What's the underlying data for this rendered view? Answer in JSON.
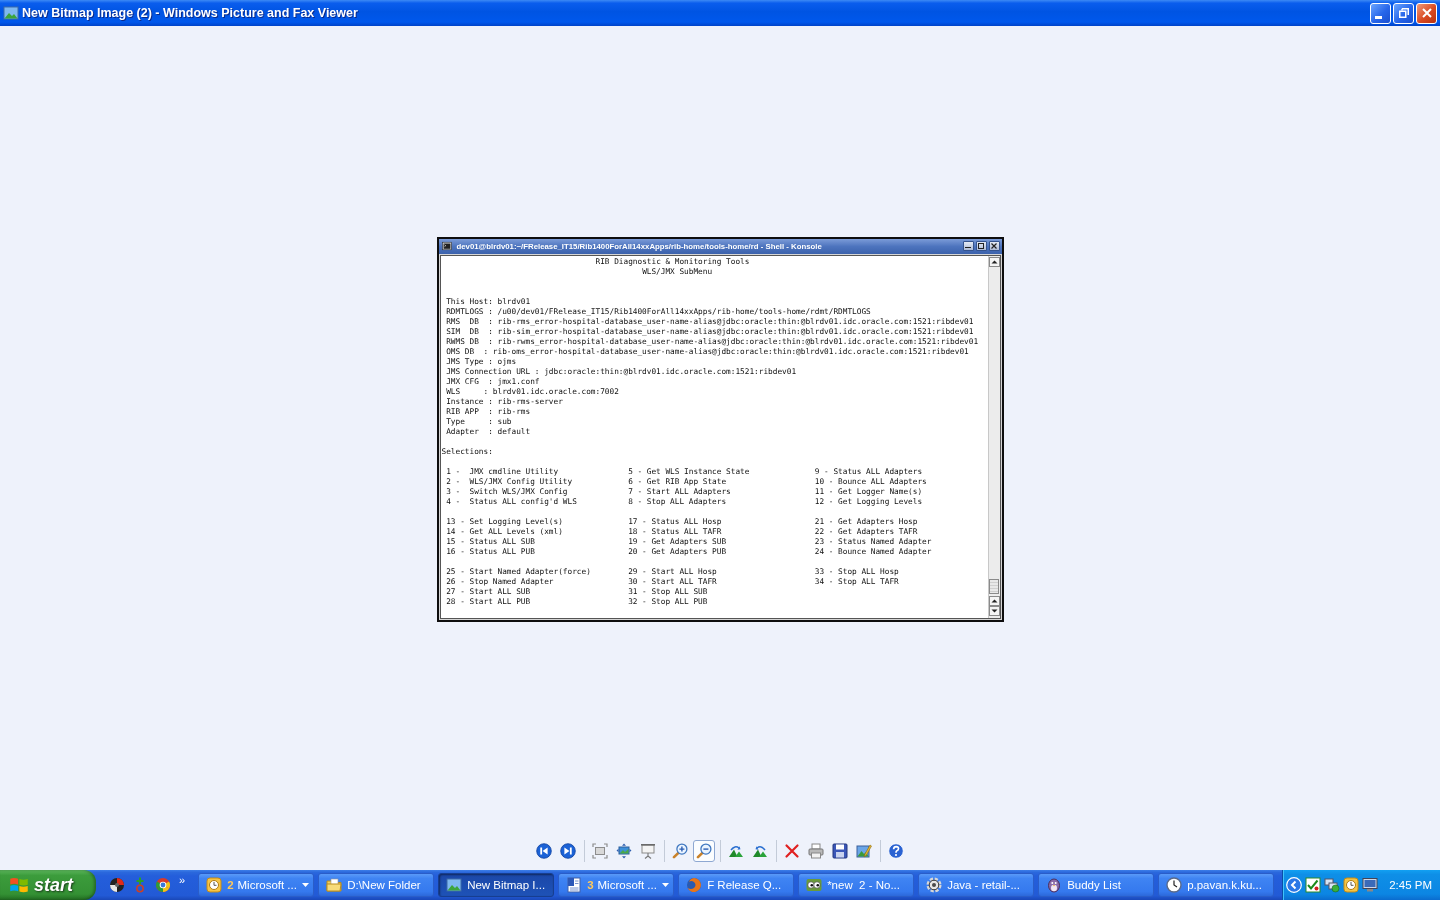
{
  "window": {
    "title": "New Bitmap Image (2) - Windows Picture and Fax Viewer"
  },
  "image": {
    "window_title": "dev01@blrdv01:~/FRelease_IT15/Rib1400ForAll14xxApps/rib-home/tools-home/rd - Shell - Konsole",
    "heading": [
      "RIB Diagnostic & Monitoring Tools",
      "WLS/JMX SubMenu"
    ],
    "info_lines": [
      "This Host: blrdv01",
      "RDMTLOGS : /u00/dev01/FRelease_IT15/Rib1400ForAll14xxApps/rib-home/tools-home/rdmt/RDMTLOGS",
      "RMS  DB  : rib-rms_error-hospital-database_user-name-alias@jdbc:oracle:thin:@blrdv01.idc.oracle.com:1521:ribdev01",
      "SIM  DB  : rib-sim_error-hospital-database_user-name-alias@jdbc:oracle:thin:@blrdv01.idc.oracle.com:1521:ribdev01",
      "RWMS DB  : rib-rwms_error-hospital-database_user-name-alias@jdbc:oracle:thin:@blrdv01.idc.oracle.com:1521:ribdev01",
      "OMS DB  : rib-oms_error-hospital-database_user-name-alias@jdbc:oracle:thin:@blrdv01.idc.oracle.com:1521:ribdev01",
      "JMS Type : ojms",
      "JMS Connection URL : jdbc:oracle:thin:@blrdv01.idc.oracle.com:1521:ribdev01",
      "JMX CFG  : jmx1.conf",
      "WLS     : blrdv01.idc.oracle.com:7002",
      "Instance : rib-rms-server",
      "RIB APP  : rib-rms",
      "Type     : sub",
      "Adapter  : default"
    ],
    "selections_label": "Selections:",
    "menu_groups": [
      [
        [
          "1 -  JMX cmdline Utility",
          "5 - Get WLS Instance State",
          "9 - Status ALL Adapters"
        ],
        [
          "2 -  WLS/JMX Config Utility",
          "6 - Get RIB App State",
          "10 - Bounce ALL Adapters"
        ],
        [
          "3 -  Switch WLS/JMX Config",
          "7 - Start ALL Adapters",
          "11 - Get Logger Name(s)"
        ],
        [
          "4 -  Status ALL config'd WLS",
          "8 - Stop ALL Adapters",
          "12 - Get Logging Levels"
        ]
      ],
      [
        [
          "13 - Set Logging Level(s)",
          "17 - Status ALL Hosp",
          "21 - Get Adapters Hosp"
        ],
        [
          "14 - Get ALL Levels (xml)",
          "18 - Status ALL TAFR",
          "22 - Get Adapters TAFR"
        ],
        [
          "15 - Status ALL SUB",
          "19 - Get Adapters SUB",
          "23 - Status Named Adapter"
        ],
        [
          "16 - Status ALL PUB",
          "20 - Get Adapters PUB",
          "24 - Bounce Named Adapter"
        ]
      ],
      [
        [
          "25 - Start Named Adapter(force)",
          "29 - Start ALL Hosp",
          "33 - Stop ALL Hosp"
        ],
        [
          "26 - Stop Named Adapter",
          "30 - Start ALL TAFR",
          "34 - Stop ALL TAFR"
        ],
        [
          "27 - Start ALL SUB",
          "31 - Stop ALL SUB"
        ],
        [
          "28 - Start ALL PUB",
          "32 - Stop ALL PUB"
        ]
      ]
    ]
  },
  "toolbar": {
    "groups": [
      [
        {
          "kind": "previous",
          "selected": false
        },
        {
          "kind": "next",
          "selected": false
        }
      ],
      [
        {
          "kind": "best_fit",
          "selected": false
        },
        {
          "kind": "actual_size",
          "selected": false
        },
        {
          "kind": "slideshow",
          "selected": false
        }
      ],
      [
        {
          "kind": "zoom_in",
          "selected": false
        },
        {
          "kind": "zoom_out",
          "selected": true
        }
      ],
      [
        {
          "kind": "rotate_clockwise",
          "selected": false
        },
        {
          "kind": "rotate_counterclockwise",
          "selected": false
        }
      ],
      [
        {
          "kind": "delete",
          "selected": false
        },
        {
          "kind": "print",
          "selected": false
        },
        {
          "kind": "save",
          "selected": false
        },
        {
          "kind": "edit",
          "selected": false
        }
      ],
      [
        {
          "kind": "help",
          "selected": false
        }
      ]
    ]
  },
  "taskbar": {
    "start": "start",
    "quick_launch_more": "»",
    "tasks": [
      {
        "count": "2",
        "label": "Microsoft ...",
        "grouped": true,
        "selected": false
      },
      {
        "label": "D:\\New Folder",
        "grouped": false,
        "selected": false
      },
      {
        "label": "New Bitmap I...",
        "grouped": false,
        "selected": true
      },
      {
        "count": "3",
        "label": "Microsoft ...",
        "grouped": true,
        "selected": false
      },
      {
        "label": "F Release Q...",
        "grouped": false,
        "selected": false
      },
      {
        "label": "*new  2 - No...",
        "grouped": false,
        "selected": false
      },
      {
        "label": "Java - retail-...",
        "grouped": false,
        "selected": false
      },
      {
        "label": "Buddy List",
        "grouped": false,
        "selected": false
      },
      {
        "label": "p.pavan.k.ku...",
        "grouped": false,
        "selected": false
      }
    ],
    "clock": "2:45 PM"
  }
}
